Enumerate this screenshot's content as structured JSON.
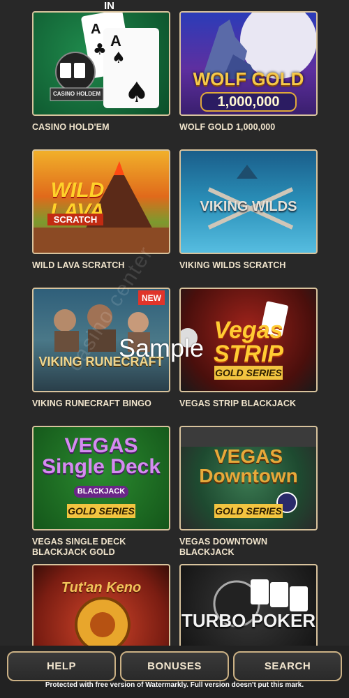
{
  "top_label": "IN",
  "games": [
    {
      "label": "CASINO HOLD'EM",
      "art_text": "CASINO HOLDEM",
      "badge": ""
    },
    {
      "label": "WOLF GOLD 1,000,000",
      "art_text": "WOLF GOLD",
      "art_sub": "1,000,000",
      "badge": ""
    },
    {
      "label": "WILD LAVA SCRATCH",
      "art_text": "WILD LAVA",
      "art_sub": "SCRATCH",
      "badge": ""
    },
    {
      "label": "VIKING WILDS SCRATCH",
      "art_text": "VIKING WILDS",
      "badge": ""
    },
    {
      "label": "VIKING RUNECRAFT BINGO",
      "art_text": "VIKING RUNECRAFT",
      "badge": "NEW"
    },
    {
      "label": "VEGAS STRIP BLACKJACK",
      "art_text": "Vegas STRIP",
      "art_sub": "GOLD SERIES",
      "badge": ""
    },
    {
      "label": "VEGAS SINGLE DECK BLACKJACK GOLD",
      "art_text": "VEGAS Single Deck",
      "art_mid": "BLACKJACK",
      "art_sub": "GOLD SERIES",
      "badge": ""
    },
    {
      "label": "VEGAS DOWNTOWN BLACKJACK",
      "art_text": "VEGAS Downtown",
      "art_sub": "GOLD SERIES",
      "badge": ""
    },
    {
      "label": "",
      "art_text": "Tut'an Keno",
      "badge": ""
    },
    {
      "label": "",
      "art_text": "TURBO POKER",
      "badge": ""
    }
  ],
  "nav": {
    "help": "HELP",
    "bonuses": "BONUSES",
    "search": "SEARCH"
  },
  "watermark": "Sample",
  "watermark_diag": "casino center",
  "footer_note": "Protected with free version of Watermarkly. Full version doesn't put this mark."
}
